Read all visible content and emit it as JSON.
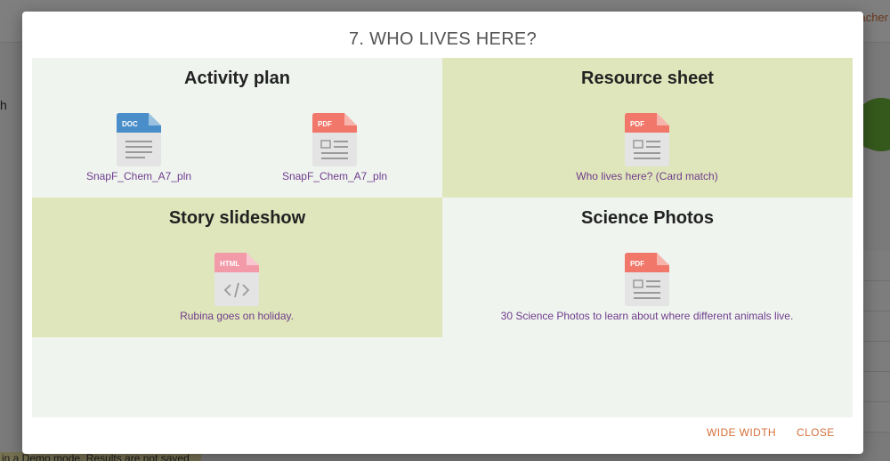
{
  "background": {
    "teacher_text": "acher",
    "left_letter": "h",
    "demo_text": "in a Demo mode. Results are not saved"
  },
  "modal": {
    "title": "7. WHO LIVES HERE?",
    "sections": [
      {
        "title": "Activity plan",
        "resources": [
          {
            "type": "DOC",
            "icon": "doc-file-icon",
            "label": "SnapF_Chem_A7_pln"
          },
          {
            "type": "PDF",
            "icon": "pdf-file-icon",
            "label": "SnapF_Chem_A7_pln"
          }
        ]
      },
      {
        "title": "Resource sheet",
        "resources": [
          {
            "type": "PDF",
            "icon": "pdf-file-icon",
            "label": "Who lives here? (Card match)"
          }
        ]
      },
      {
        "title": "Story slideshow",
        "resources": [
          {
            "type": "HTML",
            "icon": "html-file-icon",
            "label": "Rubina goes on holiday."
          }
        ]
      },
      {
        "title": "Science Photos",
        "resources": [
          {
            "type": "PDF",
            "icon": "pdf-file-icon",
            "label": "30 Science Photos to learn about where different animals live."
          }
        ]
      }
    ],
    "buttons": {
      "wide_width": "WIDE WIDTH",
      "close": "CLOSE"
    }
  },
  "colors": {
    "doc": "#4a8ec9",
    "pdf": "#f0776a",
    "html": "#f39aa8",
    "link": "#6f3c8c",
    "accent": "#d4703a"
  }
}
